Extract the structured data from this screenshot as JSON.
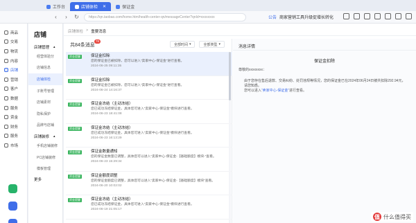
{
  "tabs": [
    {
      "label": "工作台",
      "active": false
    },
    {
      "label": "店铺体检",
      "active": true
    },
    {
      "label": "保证金",
      "active": false
    }
  ],
  "address": {
    "url": "https://qn.taobao.com/home.htm/health-center-qn/messageCenter?qnId=xxxxxxxx",
    "notice_tag": "公告",
    "notice_text": "商家营销工具升级促增长转化"
  },
  "rail": [
    {
      "label": "商品",
      "active": false
    },
    {
      "label": "交易",
      "active": false
    },
    {
      "label": "物流",
      "active": false
    },
    {
      "label": "内容",
      "active": false
    },
    {
      "label": "店铺",
      "active": true
    },
    {
      "label": "营销",
      "active": false
    },
    {
      "label": "客户",
      "active": false
    },
    {
      "label": "数据",
      "active": false
    },
    {
      "label": "服务",
      "active": false
    },
    {
      "label": "资金",
      "active": false
    },
    {
      "label": "财务",
      "active": false
    },
    {
      "label": "服务",
      "active": false
    },
    {
      "label": "市场",
      "active": false
    }
  ],
  "sidebar": {
    "title": "店铺",
    "group1": "店铺管理",
    "items1": [
      "经营体验分",
      "店铺信息",
      "店铺体检",
      "子账号管理",
      "店铺素材",
      "隐私保护",
      "品牌与店铺"
    ],
    "group2": "店铺装修",
    "items2": [
      "手机店铺装修",
      "PC店铺装修",
      "模板管理"
    ],
    "more": "更多"
  },
  "breadcrumb": {
    "parent": "店铺体检",
    "separator": ">",
    "current": "重要消息"
  },
  "list": {
    "count": "共84条消息",
    "badge": "78",
    "filter_time": "全部时间",
    "filter_type": "全部类型",
    "messages": [
      {
        "tag": "资金提醒",
        "title": "保证金扣除",
        "body": "您的保证金已被扣除，您可以进入“卖家中心-保证金”进行查看。",
        "time": "2024-06-25 09:11:35",
        "active": true
      },
      {
        "tag": "资金提醒",
        "title": "保证金扣除",
        "body": "您的保证金已被扣除，您可以进入“卖家中心-保证金”进行查看。",
        "time": "2024-06-24 14:16:37",
        "active": false
      },
      {
        "tag": "资金提醒",
        "title": "保证金冻结（主动冻结）",
        "body": "您已成功冻结保证金，具体您可进入“卖家中心-保证金”模块进行查看。",
        "time": "2024-06-23 18:41:08",
        "active": false
      },
      {
        "tag": "资金提醒",
        "title": "保证金冻结（主动冻结）",
        "body": "您已成功冻结保证金，具体您可进入“卖家中心-保证金”模块进行查看。",
        "time": "2024-06-23 16:13:29",
        "active": false
      },
      {
        "tag": "资金提醒",
        "title": "保证金数量通知",
        "body": "您的保证金数量已调整，具体您可以进入“卖家中心-保证金-【基础额度】模块-”查看。",
        "time": "2024-06-23 15:29:34",
        "active": false
      },
      {
        "tag": "资金提醒",
        "title": "保证金额度调整",
        "body": "您的保证金额度已调整，具体您可以进入“卖家中心-保证金-【基础额度】模块”查看。",
        "time": "2024-06-20 10:02:02",
        "active": false
      },
      {
        "tag": "资金提醒",
        "title": "保证金冻结（主动冻结）",
        "body": "您已成功冻结保证金，具体您可进入“卖家中心-保证金”模块进行查看。",
        "time": "2024-06-19 21:05:17",
        "active": false
      }
    ]
  },
  "detail": {
    "header": "消息详情",
    "title": "保证金扣除",
    "to": "尊敬的xxxxxxxx：",
    "body_1": "由于您存在售后退款、交易纠纷、处罚违规等情况，您的保证金已在2024年06月24日被共扣除292.94元，请您知悉。",
    "body_2_pre": "您可以进入",
    "body_2_link": "“卖家中心-保证金”",
    "body_2_post": "进行查看。"
  },
  "watermark": {
    "logo": "值",
    "text": "什么值得买"
  }
}
